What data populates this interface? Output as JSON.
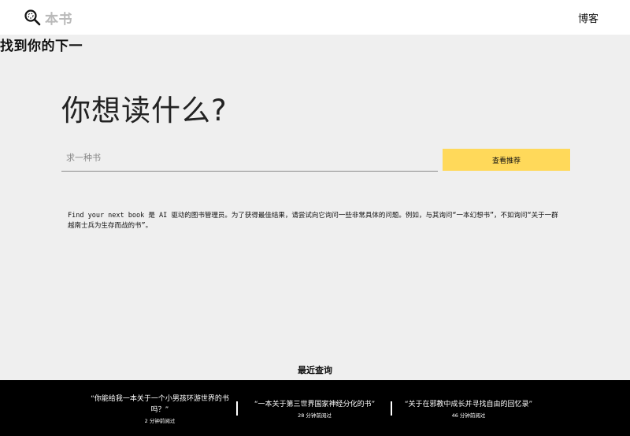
{
  "header": {
    "brand_main": "找到你的下一",
    "brand_fade": "本书",
    "blog_label": "博客"
  },
  "main": {
    "heading": "你想读什么?",
    "search_placeholder": "求一种书",
    "recommend_button": "查看推荐",
    "description": "Find your next book 是 AI 驱动的图书管理员。为了获得最佳结果，请尝试向它询问一些非常具体的问题。例如，与其询问“一本幻想书”，不如询问“关于一群越南士兵为生存而战的书”。"
  },
  "recent": {
    "title": "最近查询",
    "queries": [
      {
        "text": "“你能给我一本关于一个小男孩环游世界的书吗？”",
        "time": "2 分钟前阅过"
      },
      {
        "text": "“一本关于第三世界国家神经分化的书”",
        "time": "28 分钟前阅过"
      },
      {
        "text": "“关于在邪教中成长并寻找自由的回忆录”",
        "time": "46 分钟前阅过"
      }
    ]
  },
  "colors": {
    "accent": "#ffd95a",
    "background": "#efefef",
    "footer": "#000000",
    "brand_fade": "#b9b9b9"
  },
  "icons": {
    "brand": "magnifier-icon"
  }
}
